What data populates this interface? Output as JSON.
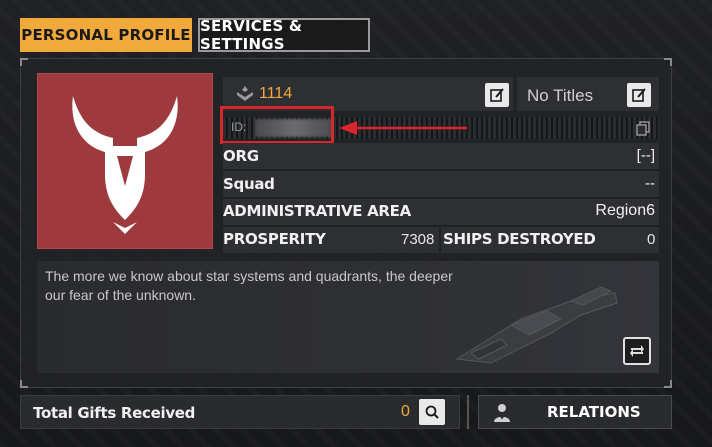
{
  "tabs": {
    "personal_profile": "PERSONAL PROFILE",
    "services_settings": "SERVICES & SETTINGS"
  },
  "profile": {
    "level": "1114",
    "titles": "No Titles",
    "id_label": "ID:",
    "quote": "The more we know about star systems and quadrants, the deeper our fear of the unknown."
  },
  "fields": {
    "org_label": "ORG",
    "org_value": "[--]",
    "squad_label": "Squad",
    "squad_value": "--",
    "area_label": "ADMINISTRATIVE AREA",
    "area_value": "Region6",
    "prosperity_label": "PROSPERITY",
    "prosperity_value": "7308",
    "ships_label": "SHIPS DESTROYED",
    "ships_value": "0"
  },
  "bottom": {
    "gifts_label": "Total Gifts Received",
    "gifts_count": "0",
    "relations_label": "RELATIONS"
  },
  "colors": {
    "accent": "#f0a93a",
    "avatar_bg": "#9e3a3e",
    "highlight": "#d7262c"
  },
  "icons": [
    "rank-icon",
    "edit-icon",
    "copy-icon",
    "search-icon",
    "swap-icon",
    "relations-icon",
    "emblem-icon"
  ]
}
